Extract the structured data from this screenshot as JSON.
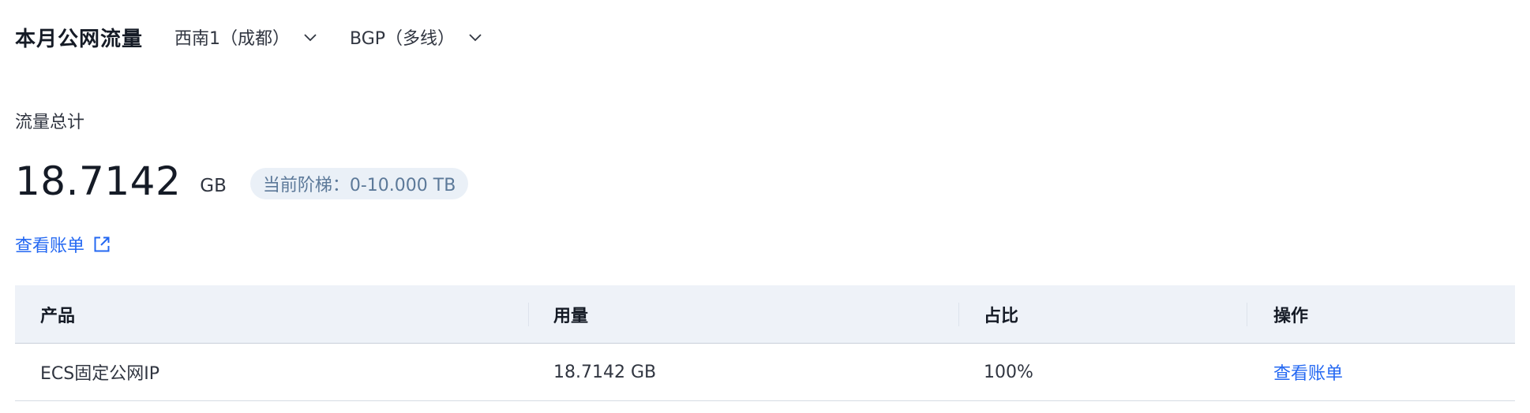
{
  "header": {
    "title": "本月公网流量",
    "region_select": {
      "value": "西南1（成都）",
      "icon": "chevron-down-icon"
    },
    "line_select": {
      "value": "BGP（多线）",
      "icon": "chevron-down-icon"
    }
  },
  "summary": {
    "label": "流量总计",
    "value": "18.7142",
    "unit": "GB",
    "tier_badge": "当前阶梯：0-10.000 TB",
    "bill_link": "查看账单",
    "bill_link_icon": "external-link-icon"
  },
  "table": {
    "columns": [
      "产品",
      "用量",
      "占比",
      "操作"
    ],
    "rows": [
      {
        "product": "ECS固定公网IP",
        "usage": "18.7142 GB",
        "ratio": "100%",
        "action": "查看账单"
      }
    ]
  },
  "colors": {
    "link": "#2468f2",
    "badge_bg": "#eaf0f7",
    "badge_text": "#5c7999",
    "table_header_bg": "#eef2f8"
  }
}
